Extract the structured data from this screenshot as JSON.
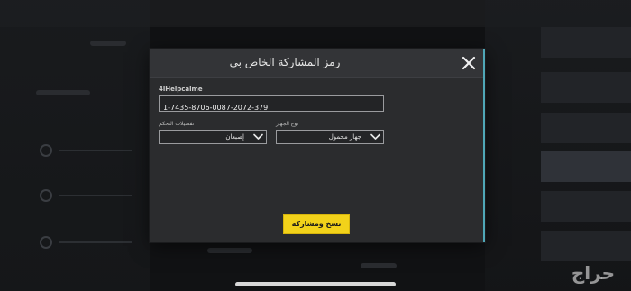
{
  "dialog": {
    "title": "رمز المشاركة الخاص بي",
    "close_icon": "close-icon",
    "code_label": "4lHelpcalme",
    "code_value": "1-7435-8706-0087-2072-379",
    "device_type": {
      "label": "نوع الجهاز",
      "value": "جهاز محمول"
    },
    "control_prefs": {
      "label": "تفضيلات التحكم",
      "value": "إصبعان"
    },
    "share_button": "نسخ ومشاركة"
  },
  "watermark": "حراج",
  "colors": {
    "accent_yellow": "#f2d21a",
    "dialog_bg": "#2b2c2e",
    "header_bg": "#333437",
    "edge_accent": "#4fa7b7"
  }
}
